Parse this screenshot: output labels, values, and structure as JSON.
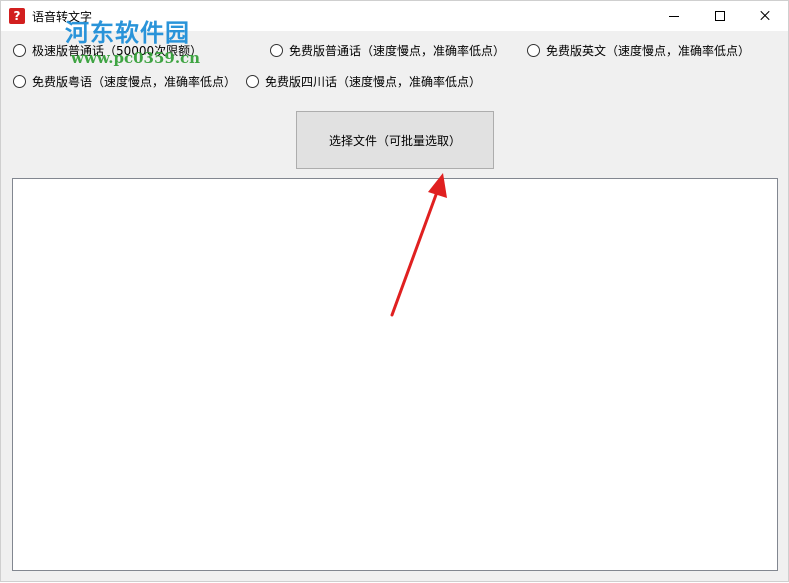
{
  "window": {
    "title": "语音转文字",
    "app_icon_glyph": "?",
    "controls": {
      "minimize": "minimize",
      "maximize": "maximize",
      "close": "close"
    }
  },
  "watermark": {
    "logo_text": "河东软件园",
    "url_text": "www.pc0359.cn"
  },
  "options": [
    {
      "label": "极速版普通话（50000次限额）",
      "selected": false
    },
    {
      "label": "免费版普通话（速度慢点，准确率低点）",
      "selected": false
    },
    {
      "label": "免费版英文（速度慢点，准确率低点）",
      "selected": false
    },
    {
      "label": "免费版粤语（速度慢点，准确率低点）",
      "selected": false
    },
    {
      "label": "免费版四川话（速度慢点，准确率低点）",
      "selected": false
    }
  ],
  "select_button": {
    "label": "选择文件（可批量选取）"
  },
  "output_text": {
    "value": ""
  },
  "annotation": {
    "arrow_color": "#e02020"
  }
}
